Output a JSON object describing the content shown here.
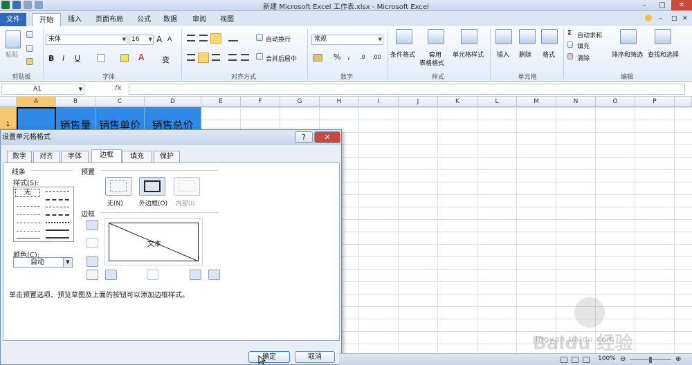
{
  "window": {
    "title": "新建 Microsoft Excel 工作表.xlsx - Microsoft Excel",
    "min": "–",
    "max": "□",
    "close": "✕"
  },
  "tabs": [
    "文件",
    "开始",
    "插入",
    "页面布局",
    "公式",
    "数据",
    "审阅",
    "视图"
  ],
  "ribbon": {
    "clipboard": {
      "paste": "粘贴",
      "label": "剪贴板"
    },
    "font": {
      "name": "宋体",
      "size": "16",
      "grow": "A",
      "shrink": "A",
      "bold": "B",
      "italic": "I",
      "underline": "U",
      "wen": "变",
      "label": "字体"
    },
    "align": {
      "wrap": "自动换行",
      "merge": "合并后居中",
      "label": "对齐方式"
    },
    "number": {
      "format": "常规",
      "percent": "%",
      "comma": ",",
      "inc": ".0",
      "dec": ".00",
      "label": "数字"
    },
    "styles": {
      "cond": "条件格式",
      "table1": "套用",
      "table2": "表格格式",
      "cell": "单元格样式",
      "label": "样式"
    },
    "cells": {
      "insert": "插入",
      "delete": "删除",
      "format": "格式",
      "label": "单元格"
    },
    "edit": {
      "autosum": "自动求和",
      "fill": "填充",
      "clear": "清除",
      "sort": "排序和筛选",
      "find": "查找和选择",
      "label": "编辑"
    }
  },
  "formula": {
    "name_box": "A1",
    "fx": "fx",
    "value": ""
  },
  "columns": [
    "A",
    "B",
    "C",
    "D",
    "E",
    "F",
    "G",
    "H",
    "I",
    "J",
    "K",
    "L",
    "M",
    "N",
    "O",
    "P"
  ],
  "row1": {
    "num": "1",
    "a": "",
    "b": "销售量",
    "c": "销售单价",
    "d": "销售总价"
  },
  "dialog": {
    "title": "设置单元格格式",
    "help": "?",
    "close": "✕",
    "tabs": [
      "数字",
      "对齐",
      "字体",
      "边框",
      "填充",
      "保护"
    ],
    "line_section": "线条",
    "style_label": "样式(S):",
    "none_style": "无",
    "color_label": "颜色(C):",
    "color_value": "自动",
    "preset_section": "预置",
    "presets": [
      "无(N)",
      "外边框(O)",
      "内部(I)"
    ],
    "border_section": "边框",
    "preview_text": "文本",
    "hint": "单击预置选项、预览草图及上面的按钮可以添加边框样式。",
    "ok": "确定",
    "cancel": "取消"
  },
  "status": {
    "zoom": "100%"
  },
  "watermark": {
    "brand": "Baidu 经验",
    "url": "jingyan.baidu.com"
  },
  "colors": {
    "accent": "#2a6bbd",
    "header_fill": "#2e8ae6"
  }
}
